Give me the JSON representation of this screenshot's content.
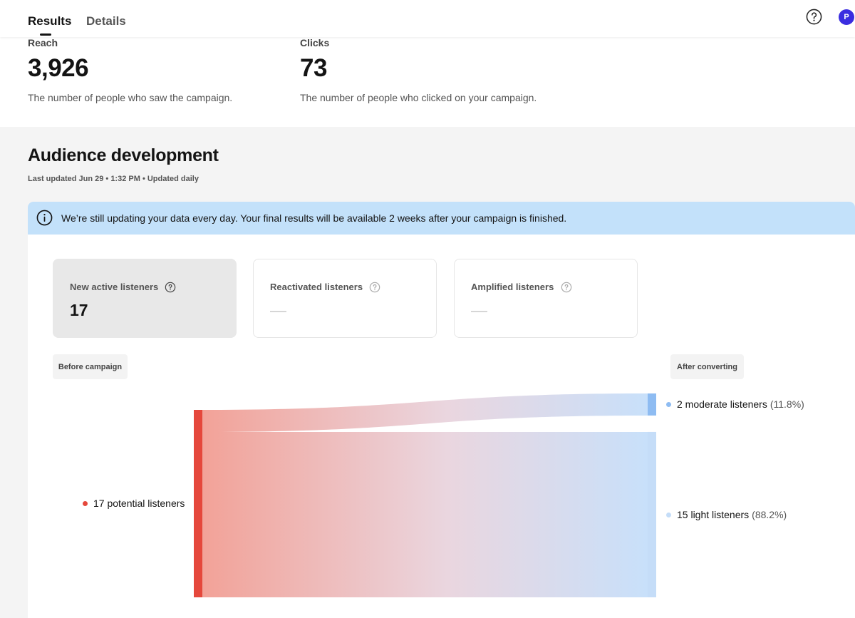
{
  "tabs": {
    "results": "Results",
    "details": "Details"
  },
  "header": {
    "help_icon": "question-circle-icon",
    "avatar_initial": "P"
  },
  "metrics": {
    "reach": {
      "label": "Reach",
      "value": "3,926",
      "description": "The number of people who saw the campaign."
    },
    "clicks": {
      "label": "Clicks",
      "value": "73",
      "description": "The number of people who clicked on your campaign."
    }
  },
  "audience": {
    "title": "Audience development",
    "subtitle": "Last updated Jun 29 • 1:32 PM • Updated daily",
    "banner": "We’re still updating your data every day. Your final results will be available 2 weeks after your campaign is finished.",
    "cards": [
      {
        "label": "New active listeners",
        "value": "17"
      },
      {
        "label": "Reactivated listeners",
        "value": "—"
      },
      {
        "label": "Amplified listeners",
        "value": "—"
      }
    ],
    "before_tag": "Before campaign",
    "after_tag": "After converting"
  },
  "chart_data": {
    "type": "sankey",
    "nodes": [
      {
        "name": "potential listeners",
        "label": "17 potential listeners",
        "value": 17,
        "color": "#e5483c"
      },
      {
        "name": "moderate listeners",
        "label": "2 moderate listeners",
        "pct": "(11.8%)",
        "value": 2,
        "color": "#8ebcf2"
      },
      {
        "name": "light listeners",
        "label": "15 light listeners",
        "pct": "(88.2%)",
        "value": 15,
        "color": "#c5ddf8"
      }
    ],
    "links": [
      {
        "source": "potential listeners",
        "target": "moderate listeners",
        "value": 2
      },
      {
        "source": "potential listeners",
        "target": "light listeners",
        "value": 15
      }
    ]
  },
  "colors": {
    "accent": "#3a2de0",
    "banner": "#c3e1fa",
    "source": "#e5483c",
    "target_moderate": "#8ebcf2",
    "target_light": "#c5ddf8"
  }
}
